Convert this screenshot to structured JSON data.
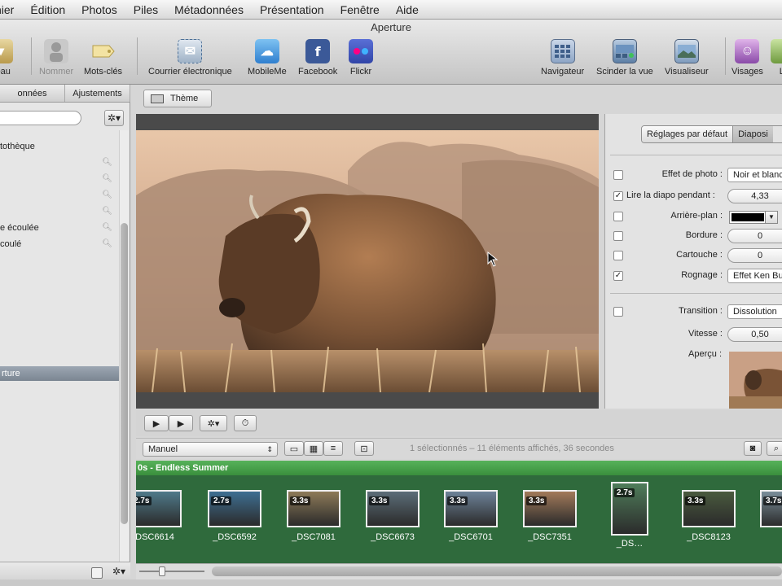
{
  "menu": [
    "hier",
    "Édition",
    "Photos",
    "Piles",
    "Métadonnées",
    "Présentation",
    "Fenêtre",
    "Aide"
  ],
  "app_title": "Aperture",
  "toolbar": {
    "left_partial_label": "veau",
    "name_label": "Nommer",
    "keywords_label": "Mots-clés",
    "email_label": "Courrier électronique",
    "mobileme_label": "MobileMe",
    "facebook_label": "Facebook",
    "flickr_label": "Flickr",
    "navigator_label": "Navigateur",
    "split_view_label": "Scinder la vue",
    "viewer_label": "Visualiseur",
    "faces_label": "Visages",
    "partial_right_label": "Li"
  },
  "left_panel": {
    "tabs": [
      "onnées",
      "Ajustements"
    ],
    "items": [
      {
        "label": "tothèque",
        "search": false
      },
      {
        "label": "",
        "search": true
      },
      {
        "label": "",
        "search": true
      },
      {
        "label": "",
        "search": true
      },
      {
        "label": "",
        "search": true
      },
      {
        "label": "e écoulée",
        "search": true
      },
      {
        "label": "coulé",
        "search": true
      }
    ],
    "selected_item": "rture"
  },
  "viewer": {
    "theme_button": "Thème"
  },
  "inspector": {
    "segments": [
      "Réglages par défaut",
      "Diaposi"
    ],
    "rows": {
      "photo_effect": {
        "label": "Effet de photo :",
        "value": "Noir et blanc",
        "checked": false
      },
      "play_slide": {
        "label": "Lire la diapo pendant :",
        "value": "4,33",
        "checked": true
      },
      "background": {
        "label": "Arrière-plan :",
        "checked": false
      },
      "border": {
        "label": "Bordure :",
        "value": "0",
        "checked": false
      },
      "caption": {
        "label": "Cartouche :",
        "value": "0",
        "checked": false
      },
      "crop": {
        "label": "Rognage :",
        "value": "Effet Ken Burns",
        "checked": true
      },
      "transition": {
        "label": "Transition :",
        "value": "Dissolution",
        "checked": false
      },
      "speed": {
        "label": "Vitesse :",
        "value": "0,50"
      }
    },
    "preview_label": "Aperçu :",
    "background_color": "#000000"
  },
  "sort": {
    "mode": "Manuel",
    "status": "1 sélectionnés – 11 éléments affichés, 36 secondes"
  },
  "filmstrip": {
    "header": "0s - Endless Summer",
    "items": [
      {
        "duration": "2.7s",
        "name": "DSC6614",
        "tone": "#4f7a8a"
      },
      {
        "duration": "2.7s",
        "name": "_DSC6592",
        "tone": "#3e6f92"
      },
      {
        "duration": "3.3s",
        "name": "_DSC7081",
        "tone": "#8d7a58"
      },
      {
        "duration": "3.3s",
        "name": "_DSC6673",
        "tone": "#5c6d78"
      },
      {
        "duration": "3.3s",
        "name": "_DSC6701",
        "tone": "#6d8298"
      },
      {
        "duration": "3.3s",
        "name": "_DSC7351",
        "tone": "#a27a5a"
      },
      {
        "duration": "2.7s",
        "name": "_DS…",
        "tone": "#4f7d5a"
      },
      {
        "duration": "3.3s",
        "name": "_DSC8123",
        "tone": "#4a5a3e"
      },
      {
        "duration": "3.7s",
        "name": "",
        "tone": "#7a8e9a"
      }
    ]
  },
  "colors": {
    "film_green": "#2f6a3c",
    "film_header_green": "#4aa24d",
    "selection_blue_gray": "#8892a0"
  }
}
